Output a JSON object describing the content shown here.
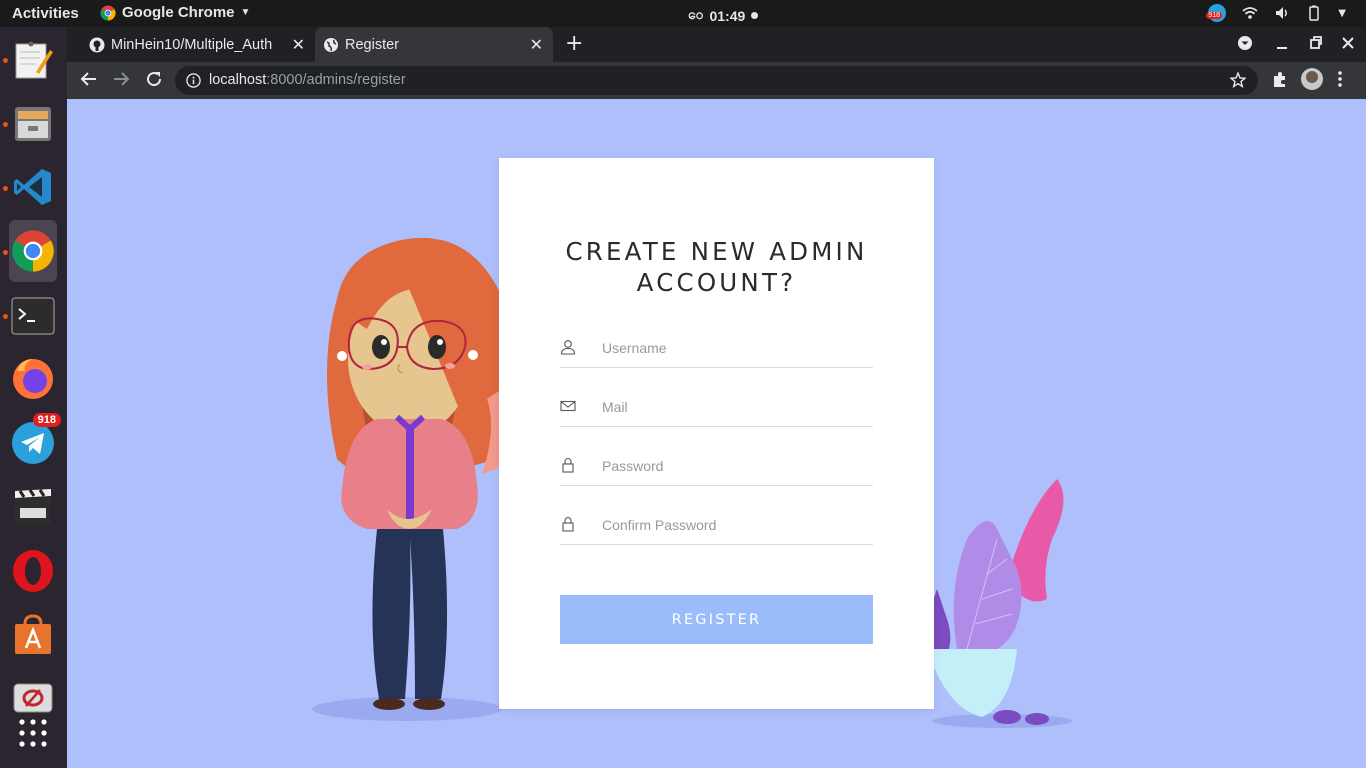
{
  "system_bar": {
    "activities": "Activities",
    "app_name": "Google Chrome",
    "clock_prefix": "ဝေ",
    "clock": "01:49",
    "telegram_tray_badge": "918"
  },
  "dock": {
    "items": [
      {
        "icon": "text-editor-icon"
      },
      {
        "icon": "file-manager-icon"
      },
      {
        "icon": "vscode-icon"
      },
      {
        "icon": "chrome-icon"
      },
      {
        "icon": "terminal-icon"
      },
      {
        "icon": "firefox-icon"
      },
      {
        "icon": "telegram-icon",
        "badge": "918"
      },
      {
        "icon": "video-editor-icon"
      },
      {
        "icon": "opera-icon"
      },
      {
        "icon": "software-center-icon"
      },
      {
        "icon": "remote-desktop-icon"
      },
      {
        "icon": "app-grid-icon"
      }
    ]
  },
  "browser": {
    "tabs": [
      {
        "title": "MinHein10/Multiple_Auth",
        "active": false
      },
      {
        "title": "Register",
        "active": true
      }
    ],
    "url_host": "localhost",
    "url_path": ":8000/admins/register"
  },
  "page": {
    "heading": "CREATE NEW ADMIN ACCOUNT?",
    "fields": {
      "username_placeholder": "Username",
      "mail_placeholder": "Mail",
      "password_placeholder": "Password",
      "confirm_placeholder": "Confirm Password"
    },
    "register_button": "REGISTER"
  },
  "colors": {
    "page_background": "#aebffb",
    "button": "#9bbcfb",
    "card": "#ffffff"
  }
}
